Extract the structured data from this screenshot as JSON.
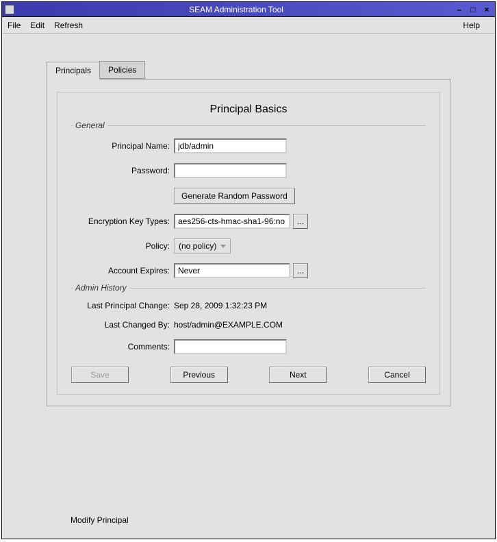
{
  "window": {
    "title": "SEAM Administration Tool"
  },
  "menubar": {
    "file": "File",
    "edit": "Edit",
    "refresh": "Refresh",
    "help": "Help"
  },
  "tabs": {
    "principals": "Principals",
    "policies": "Policies"
  },
  "heading": "Principal Basics",
  "sections": {
    "general": "General",
    "admin_history": "Admin History"
  },
  "labels": {
    "principal_name": "Principal Name:",
    "password": "Password:",
    "encryption": "Encryption Key Types:",
    "policy": "Policy:",
    "account_expires": "Account Expires:",
    "last_change": "Last Principal Change:",
    "last_changed_by": "Last Changed By:",
    "comments": "Comments:"
  },
  "values": {
    "principal_name": "jdb/admin",
    "password": "",
    "encryption": "aes256-cts-hmac-sha1-96:no",
    "policy": "(no policy)",
    "account_expires": "Never",
    "last_change": "Sep 28, 2009 1:32:23 PM",
    "last_changed_by": "host/admin@EXAMPLE.COM",
    "comments": ""
  },
  "buttons": {
    "gen_pass": "Generate Random Password",
    "browse": "...",
    "save": "Save",
    "previous": "Previous",
    "next": "Next",
    "cancel": "Cancel"
  },
  "status": "Modify Principal"
}
